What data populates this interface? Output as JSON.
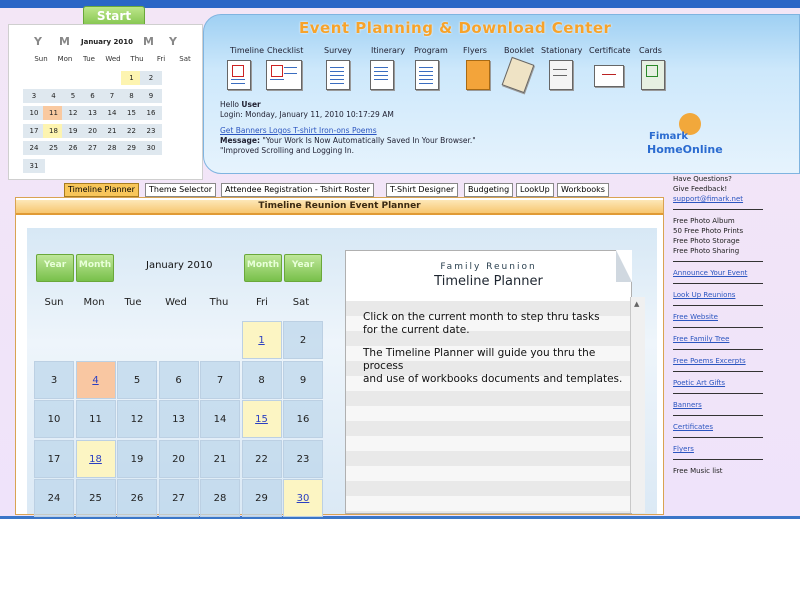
{
  "start_label": "Start",
  "mini_calendar": {
    "nav": [
      "Y",
      "M",
      "M",
      "Y"
    ],
    "month_title": "January 2010",
    "weekdays": [
      "Sun",
      "Mon",
      "Tue",
      "Wed",
      "Thu",
      "Fri",
      "Sat"
    ],
    "weeks": [
      [
        "",
        "",
        "",
        "",
        "",
        "1",
        "2"
      ],
      [
        "3",
        "4",
        "5",
        "6",
        "7",
        "8",
        "9"
      ],
      [
        "10",
        "11",
        "12",
        "13",
        "14",
        "15",
        "16"
      ],
      [
        "17",
        "18",
        "19",
        "20",
        "21",
        "22",
        "23"
      ],
      [
        "24",
        "25",
        "26",
        "27",
        "28",
        "29",
        "30"
      ],
      [
        "31",
        "",
        "",
        "",
        "",
        "",
        ""
      ]
    ]
  },
  "header": {
    "title": "Event Planning & Download Center",
    "tools": [
      "Timeline",
      "Checklist",
      "Survey",
      "Itinerary",
      "Program",
      "Flyers",
      "Booklet",
      "Stationary",
      "Certificate",
      "Cards"
    ],
    "hello_prefix": "Hello ",
    "user": "User",
    "login": "Login: Monday, January 11, 2010 10:17:29 AM",
    "banner_link": "Get Banners Logos T-shirt Iron-ons Poems",
    "message_label": "Message:",
    "message_text": "\"Your Work Is Now Automatically Saved In Your Browser.\"",
    "message_line2": "\"Improved Scrolling and Logging In.",
    "logo_line1": "Fimark",
    "logo_line2": "HomeOnline"
  },
  "tabs": [
    "Timeline Planner",
    "Theme Selector",
    "Attendee Registration - Tshirt Roster",
    "T-Shirt Designer",
    "Budgeting",
    "LookUp",
    "Workbooks"
  ],
  "panel": {
    "title": "Timeline Reunion Event Planner",
    "calendar": {
      "btn_year": "Year",
      "btn_month": "Month",
      "month_title": "January  2010",
      "weekdays": [
        "Sun",
        "Mon",
        "Tue",
        "Wed",
        "Thu",
        "Fri",
        "Sat"
      ],
      "weeks": [
        [
          "",
          "",
          "",
          "",
          "",
          "1",
          "2"
        ],
        [
          "3",
          "4",
          "5",
          "6",
          "7",
          "8",
          "9"
        ],
        [
          "10",
          "11",
          "12",
          "13",
          "14",
          "15",
          "16"
        ],
        [
          "17",
          "18",
          "19",
          "20",
          "21",
          "22",
          "23"
        ],
        [
          "24",
          "25",
          "26",
          "27",
          "28",
          "29",
          "30"
        ]
      ]
    },
    "planner": {
      "subtitle": "Family Reunion",
      "title": "Timeline Planner",
      "line1": "Click on the current month to step thru tasks",
      "line2": "for the current date.",
      "line3": "The Timeline Planner will guide you thru the process",
      "line4": "and use of workbooks documents and templates."
    }
  },
  "sidebar": {
    "q1": "Have Questions?",
    "q2": "Give Feedback!",
    "email": "support@fimark.net",
    "free_list": [
      "Free Photo Album",
      "50 Free Photo Prints",
      "Free Photo Storage",
      "Free Photo Sharing"
    ],
    "links": [
      "Announce Your Event",
      "Look Up Reunions",
      "Free Website",
      "Free Family Tree",
      "Free Poems Excerpts",
      "Poetic Art Gifts",
      "Banners",
      "Certificates",
      "Flyers"
    ],
    "music": "Free Music list"
  }
}
